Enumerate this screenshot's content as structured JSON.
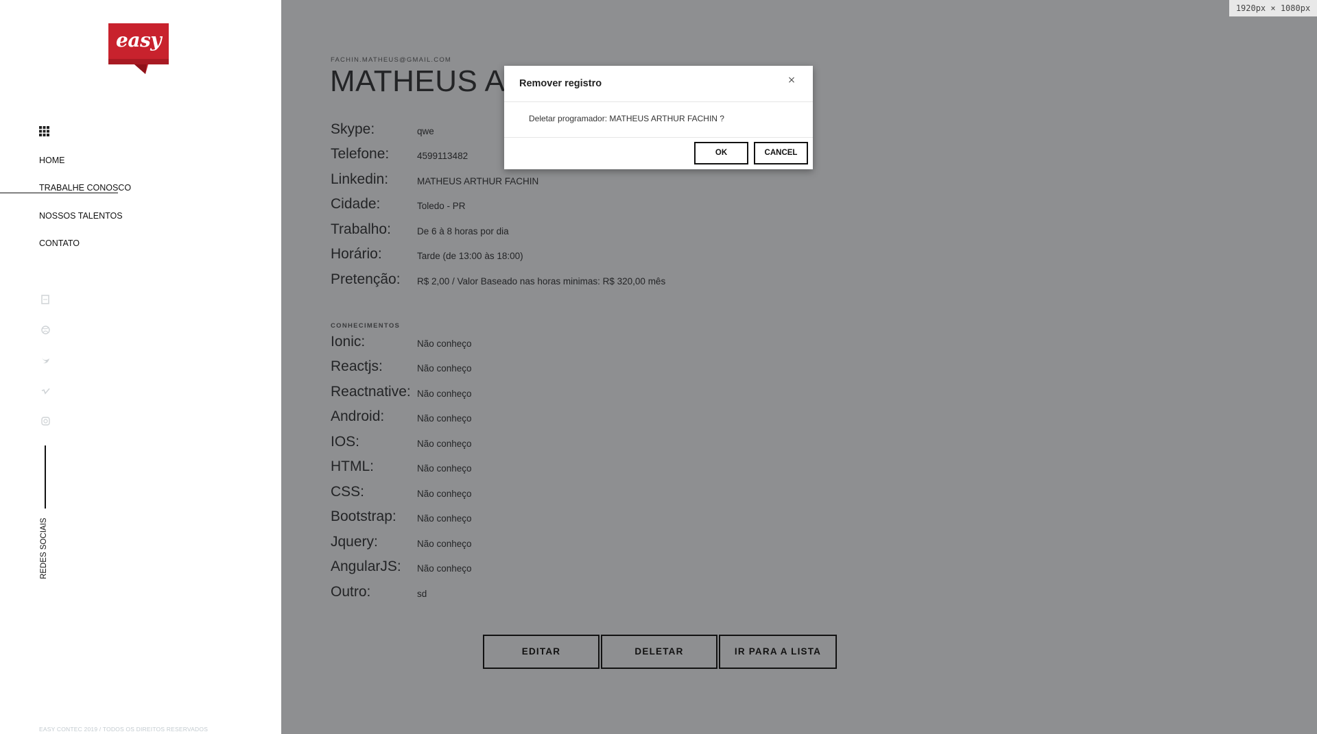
{
  "sidebar": {
    "logo_text": "easy",
    "nav": [
      {
        "label": "HOME",
        "active": false
      },
      {
        "label": "TRABALHE CONOSCO",
        "active": true
      },
      {
        "label": "NOSSOS TALENTOS",
        "active": false
      },
      {
        "label": "CONTATO",
        "active": false
      }
    ],
    "social_icons": [
      "behance-icon",
      "dribbble-icon",
      "twitter-icon",
      "vimeo-icon",
      "instagram-icon"
    ],
    "redes_label": "REDES SOCIAIS",
    "copyright": "EASY CONTEC 2019 / TODOS OS DIREITOS RESERVADOS"
  },
  "profile": {
    "email": "FACHIN.MATHEUS@GMAIL.COM",
    "name": "MATHEUS ARTHUR FACHIN",
    "fields": [
      {
        "label": "Skype:",
        "value": "qwe"
      },
      {
        "label": "Telefone:",
        "value": "4599113482"
      },
      {
        "label": "Linkedin:",
        "value": "MATHEUS ARTHUR FACHIN"
      },
      {
        "label": "Cidade:",
        "value": "Toledo - PR"
      },
      {
        "label": "Trabalho:",
        "value": "De 6 à 8 horas por dia"
      },
      {
        "label": "Horário:",
        "value": "Tarde (de 13:00 às 18:00)"
      },
      {
        "label": "Pretenção:",
        "value": "R$ 2,00 / Valor Baseado nas horas minimas: R$ 320,00 mês"
      }
    ],
    "skills_title": "CONHECIMENTOS",
    "skills": [
      {
        "label": "Ionic:",
        "value": "Não conheço"
      },
      {
        "label": "Reactjs:",
        "value": "Não conheço"
      },
      {
        "label": "Reactnative:",
        "value": "Não conheço"
      },
      {
        "label": "Android:",
        "value": "Não conheço"
      },
      {
        "label": "IOS:",
        "value": "Não conheço"
      },
      {
        "label": "HTML:",
        "value": "Não conheço"
      },
      {
        "label": "CSS:",
        "value": "Não conheço"
      },
      {
        "label": "Bootstrap:",
        "value": "Não conheço"
      },
      {
        "label": "Jquery:",
        "value": "Não conheço"
      },
      {
        "label": "AngularJS:",
        "value": "Não conheço"
      },
      {
        "label": "Outro:",
        "value": "sd"
      }
    ],
    "actions": {
      "edit": "EDITAR",
      "delete": "DELETAR",
      "list": "IR PARA A LISTA"
    }
  },
  "modal": {
    "title": "Remover registro",
    "close": "×",
    "message": "Deletar programador: MATHEUS ARTHUR FACHIN ?",
    "ok": "OK",
    "cancel": "CANCEL"
  },
  "viewport_badge": "1920px × 1080px",
  "colors": {
    "overlay": "#8e8f91",
    "brand_red": "#c8222d",
    "sidebar_bg": "#ffffff"
  }
}
